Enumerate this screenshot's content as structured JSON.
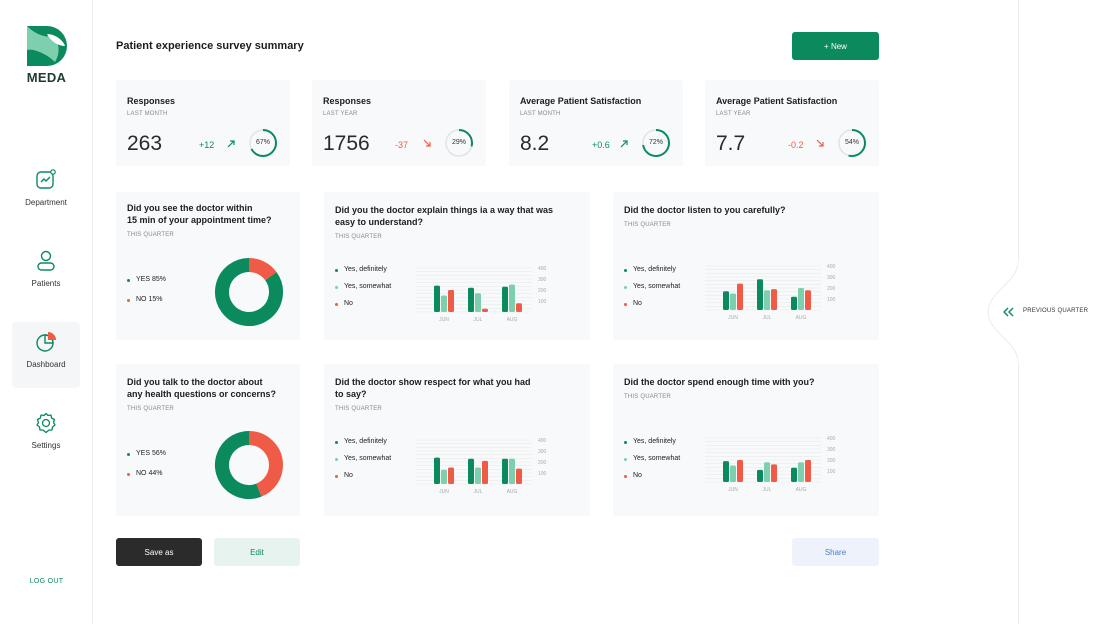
{
  "brand": {
    "name": "MEDA",
    "primary": "#0b8a5e",
    "light": "#7ecfae",
    "alert": "#ef5b46"
  },
  "sidebar": {
    "items": [
      {
        "label": "Department",
        "icon": "chart-icon"
      },
      {
        "label": "Patients",
        "icon": "user-icon"
      },
      {
        "label": "Dashboard",
        "icon": "pie-icon",
        "active": true
      },
      {
        "label": "Settings",
        "icon": "gear-icon"
      }
    ],
    "logout": "LOG OUT"
  },
  "header": {
    "title": "Patient experience survey summary",
    "new_label": "+ New"
  },
  "stats": [
    {
      "title": "Responses",
      "sub": "LAST MONTH",
      "value": "263",
      "delta": "+12",
      "dir": "up",
      "pct_label": "67%",
      "pct": 0.67
    },
    {
      "title": "Responses",
      "sub": "LAST YEAR",
      "value": "1756",
      "delta": "-37",
      "dir": "down",
      "pct_label": "29%",
      "pct": 0.29
    },
    {
      "title": "Average Patient Satisfaction",
      "sub": "LAST MONTH",
      "value": "8.2",
      "delta": "+0.6",
      "dir": "up",
      "pct_label": "72%",
      "pct": 0.72
    },
    {
      "title": "Average Patient Satisfaction",
      "sub": "LAST YEAR",
      "value": "7.7",
      "delta": "-0.2",
      "dir": "down",
      "pct_label": "54%",
      "pct": 0.54
    }
  ],
  "donuts": [
    {
      "q1": "Did you see the doctor within",
      "q2": "15 min of your appointment time?",
      "sub": "THIS QUARTER",
      "yes_label": "YES 85%",
      "no_label": "NO 15%",
      "yes": 85,
      "no": 15
    },
    {
      "q1": "Did you talk to the doctor about",
      "q2": "any health questions or concerns?",
      "sub": "THIS QUARTER",
      "yes_label": "YES 56%",
      "no_label": "NO 44%",
      "yes": 56,
      "no": 44
    }
  ],
  "bar_cards": [
    {
      "q1": "Did you the doctor explain things ia a way that was",
      "q2": "easy to understand?",
      "sub": "THIS QUARTER",
      "legend": [
        "Yes, definitely",
        "Yes, somewhat",
        "No"
      ],
      "months": [
        "JUN",
        "JUL",
        "AUG"
      ],
      "ticks": [
        "400",
        "300",
        "200",
        "100"
      ],
      "values": [
        [
          240,
          150,
          200
        ],
        [
          220,
          170,
          30
        ],
        [
          230,
          250,
          80
        ]
      ]
    },
    {
      "q1": "Did the doctor listen to you carefully?",
      "q2": "",
      "sub": "THIS QUARTER",
      "legend": [
        "Yes, definitely",
        "Yes, somewhat",
        "No"
      ],
      "months": [
        "JUN",
        "JUL",
        "AUG"
      ],
      "ticks": [
        "400",
        "300",
        "200",
        "100"
      ],
      "values": [
        [
          170,
          150,
          240
        ],
        [
          280,
          180,
          190
        ],
        [
          120,
          200,
          180
        ]
      ]
    },
    {
      "q1": "Did the doctor show respect for what you had",
      "q2": "to say?",
      "sub": "THIS QUARTER",
      "legend": [
        "Yes, definitely",
        "Yes, somewhat",
        "No"
      ],
      "months": [
        "JUN",
        "JUL",
        "AUG"
      ],
      "ticks": [
        "400",
        "300",
        "200",
        "100"
      ],
      "values": [
        [
          240,
          130,
          150
        ],
        [
          230,
          150,
          210
        ],
        [
          230,
          230,
          140
        ]
      ]
    },
    {
      "q1": "Did the doctor spend enough time with you?",
      "q2": "",
      "sub": "THIS QUARTER",
      "legend": [
        "Yes, definitely",
        "Yes, somewhat",
        "No"
      ],
      "months": [
        "JUN",
        "JUL",
        "AUG"
      ],
      "ticks": [
        "400",
        "300",
        "200",
        "100"
      ],
      "values": [
        [
          190,
          150,
          200
        ],
        [
          110,
          180,
          160
        ],
        [
          130,
          180,
          200
        ]
      ]
    }
  ],
  "footer": {
    "save_label": "Save as",
    "edit_label": "Edit",
    "share_label": "Share"
  },
  "right": {
    "prev_label": "PREVIOUS QUARTER"
  }
}
